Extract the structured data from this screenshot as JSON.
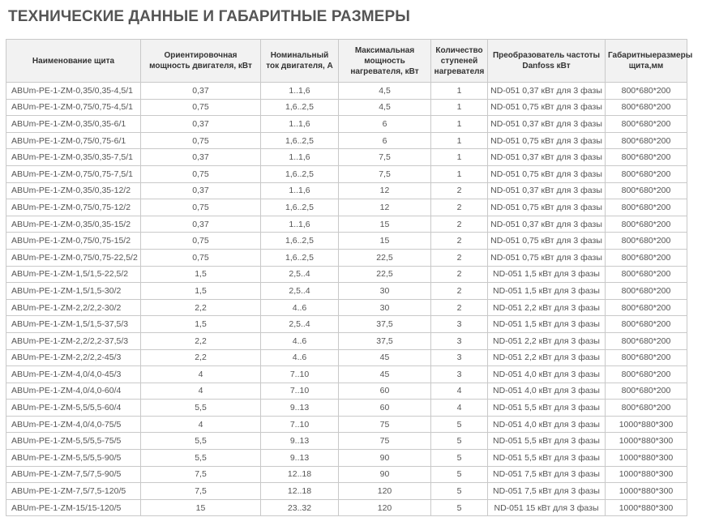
{
  "title": "ТЕХНИЧЕСКИЕ ДАННЫЕ И ГАБАРИТНЫЕ РАЗМЕРЫ",
  "table": {
    "headers": [
      "Наименование щита",
      "Ориентировочная мощность двигателя, кВт",
      "Номинальный ток двигателя, А",
      "Максимальная мощность нагревателя, кВт",
      "Количество ступеней нагревателя",
      "Преобразователь частоты Danfoss кВт",
      "Габаритныеразмеры щита,мм"
    ],
    "rows": [
      [
        "ABUm-PE-1-ZM-0,35/0,35-4,5/1",
        "0,37",
        "1..1,6",
        "4,5",
        "1",
        "ND-051 0,37 кВт для 3 фазы",
        "800*680*200"
      ],
      [
        "ABUm-PE-1-ZM-0,75/0,75-4,5/1",
        "0,75",
        "1,6..2,5",
        "4,5",
        "1",
        "ND-051 0,75 кВт для 3 фазы",
        "800*680*200"
      ],
      [
        "ABUm-PE-1-ZM-0,35/0,35-6/1",
        "0,37",
        "1..1,6",
        "6",
        "1",
        "ND-051 0,37 кВт для 3 фазы",
        "800*680*200"
      ],
      [
        "ABUm-PE-1-ZM-0,75/0,75-6/1",
        "0,75",
        "1,6..2,5",
        "6",
        "1",
        "ND-051 0,75 кВт для 3 фазы",
        "800*680*200"
      ],
      [
        "ABUm-PE-1-ZM-0,35/0,35-7,5/1",
        "0,37",
        "1..1,6",
        "7,5",
        "1",
        "ND-051 0,37 кВт для 3 фазы",
        "800*680*200"
      ],
      [
        "ABUm-PE-1-ZM-0,75/0,75-7,5/1",
        "0,75",
        "1,6..2,5",
        "7,5",
        "1",
        "ND-051 0,75 кВт для 3 фазы",
        "800*680*200"
      ],
      [
        "ABUm-PE-1-ZM-0,35/0,35-12/2",
        "0,37",
        "1..1,6",
        "12",
        "2",
        "ND-051 0,37 кВт для 3 фазы",
        "800*680*200"
      ],
      [
        "ABUm-PE-1-ZM-0,75/0,75-12/2",
        "0,75",
        "1,6..2,5",
        "12",
        "2",
        "ND-051 0,75 кВт для 3 фазы",
        "800*680*200"
      ],
      [
        "ABUm-PE-1-ZM-0,35/0,35-15/2",
        "0,37",
        "1..1,6",
        "15",
        "2",
        "ND-051 0,37 кВт для 3 фазы",
        "800*680*200"
      ],
      [
        "ABUm-PE-1-ZM-0,75/0,75-15/2",
        "0,75",
        "1,6..2,5",
        "15",
        "2",
        "ND-051 0,75 кВт для 3 фазы",
        "800*680*200"
      ],
      [
        "ABUm-PE-1-ZM-0,75/0,75-22,5/2",
        "0,75",
        "1,6..2,5",
        "22,5",
        "2",
        "ND-051 0,75 кВт для 3 фазы",
        "800*680*200"
      ],
      [
        "ABUm-PE-1-ZM-1,5/1,5-22,5/2",
        "1,5",
        "2,5..4",
        "22,5",
        "2",
        "ND-051 1,5 кВт для 3 фазы",
        "800*680*200"
      ],
      [
        "ABUm-PE-1-ZM-1,5/1,5-30/2",
        "1,5",
        "2,5..4",
        "30",
        "2",
        "ND-051 1,5 кВт для 3 фазы",
        "800*680*200"
      ],
      [
        "ABUm-PE-1-ZM-2,2/2,2-30/2",
        "2,2",
        "4..6",
        "30",
        "2",
        "ND-051 2,2 кВт для 3 фазы",
        "800*680*200"
      ],
      [
        "ABUm-PE-1-ZM-1,5/1,5-37,5/3",
        "1,5",
        "2,5..4",
        "37,5",
        "3",
        "ND-051 1,5 кВт для 3 фазы",
        "800*680*200"
      ],
      [
        "ABUm-PE-1-ZM-2,2/2,2-37,5/3",
        "2,2",
        "4..6",
        "37,5",
        "3",
        "ND-051 2,2 кВт для 3 фазы",
        "800*680*200"
      ],
      [
        "ABUm-PE-1-ZM-2,2/2,2-45/3",
        "2,2",
        "4..6",
        "45",
        "3",
        "ND-051 2,2 кВт для 3 фазы",
        "800*680*200"
      ],
      [
        "ABUm-PE-1-ZM-4,0/4,0-45/3",
        "4",
        "7..10",
        "45",
        "3",
        "ND-051 4,0 кВт для 3 фазы",
        "800*680*200"
      ],
      [
        "ABUm-PE-1-ZM-4,0/4,0-60/4",
        "4",
        "7..10",
        "60",
        "4",
        "ND-051 4,0 кВт для 3 фазы",
        "800*680*200"
      ],
      [
        "ABUm-PE-1-ZM-5,5/5,5-60/4",
        "5,5",
        "9..13",
        "60",
        "4",
        "ND-051 5,5 кВт для 3 фазы",
        "800*680*200"
      ],
      [
        "ABUm-PE-1-ZM-4,0/4,0-75/5",
        "4",
        "7..10",
        "75",
        "5",
        "ND-051 4,0 кВт для 3 фазы",
        "1000*880*300"
      ],
      [
        "ABUm-PE-1-ZM-5,5/5,5-75/5",
        "5,5",
        "9..13",
        "75",
        "5",
        "ND-051 5,5 кВт для 3 фазы",
        "1000*880*300"
      ],
      [
        "ABUm-PE-1-ZM-5,5/5,5-90/5",
        "5,5",
        "9..13",
        "90",
        "5",
        "ND-051 5,5 кВт для 3 фазы",
        "1000*880*300"
      ],
      [
        "ABUm-PE-1-ZM-7,5/7,5-90/5",
        "7,5",
        "12..18",
        "90",
        "5",
        "ND-051 7,5 кВт для 3 фазы",
        "1000*880*300"
      ],
      [
        "ABUm-PE-1-ZM-7,5/7,5-120/5",
        "7,5",
        "12..18",
        "120",
        "5",
        "ND-051 7,5 кВт для 3 фазы",
        "1000*880*300"
      ],
      [
        "ABUm-PE-1-ZM-15/15-120/5",
        "15",
        "23..32",
        "120",
        "5",
        "ND-051 15 кВт для 3 фазы",
        "1000*880*300"
      ]
    ]
  }
}
